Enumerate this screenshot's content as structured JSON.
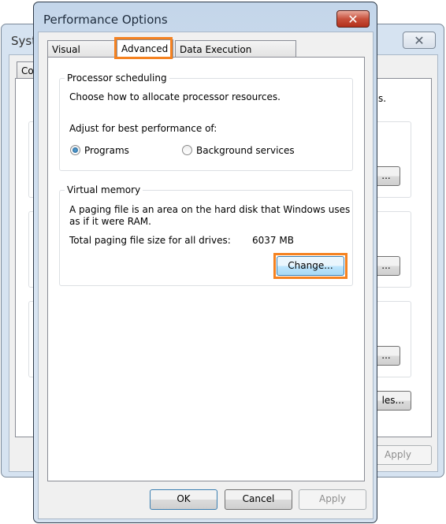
{
  "background_window": {
    "title": "System Properties",
    "title_visible": "Syst",
    "tab_visible": "Co",
    "text_fragment": "s.",
    "button_fragments": [
      "...",
      "...",
      "..."
    ],
    "variables_button_fragment": "les...",
    "apply_label": "Apply"
  },
  "dialog": {
    "title": "Performance Options",
    "tabs": [
      {
        "label": "Visual Effects",
        "active": false
      },
      {
        "label": "Advanced",
        "active": true
      },
      {
        "label": "Data Execution Prevention",
        "active": false
      }
    ],
    "processor": {
      "title": "Processor scheduling",
      "description": "Choose how to allocate processor resources.",
      "adjust_label": "Adjust for best performance of:",
      "options": [
        {
          "label": "Programs",
          "selected": true
        },
        {
          "label": "Background services",
          "selected": false
        }
      ]
    },
    "virtual_memory": {
      "title": "Virtual memory",
      "description_line1": "A paging file is an area on the hard disk that Windows uses",
      "description_line2": "as if it were RAM.",
      "total_label": "Total paging file size for all drives:",
      "total_value": "6037 MB",
      "change_label": "Change..."
    },
    "buttons": {
      "ok": "OK",
      "cancel": "Cancel",
      "apply": "Apply"
    },
    "highlight_color": "#f58220"
  }
}
